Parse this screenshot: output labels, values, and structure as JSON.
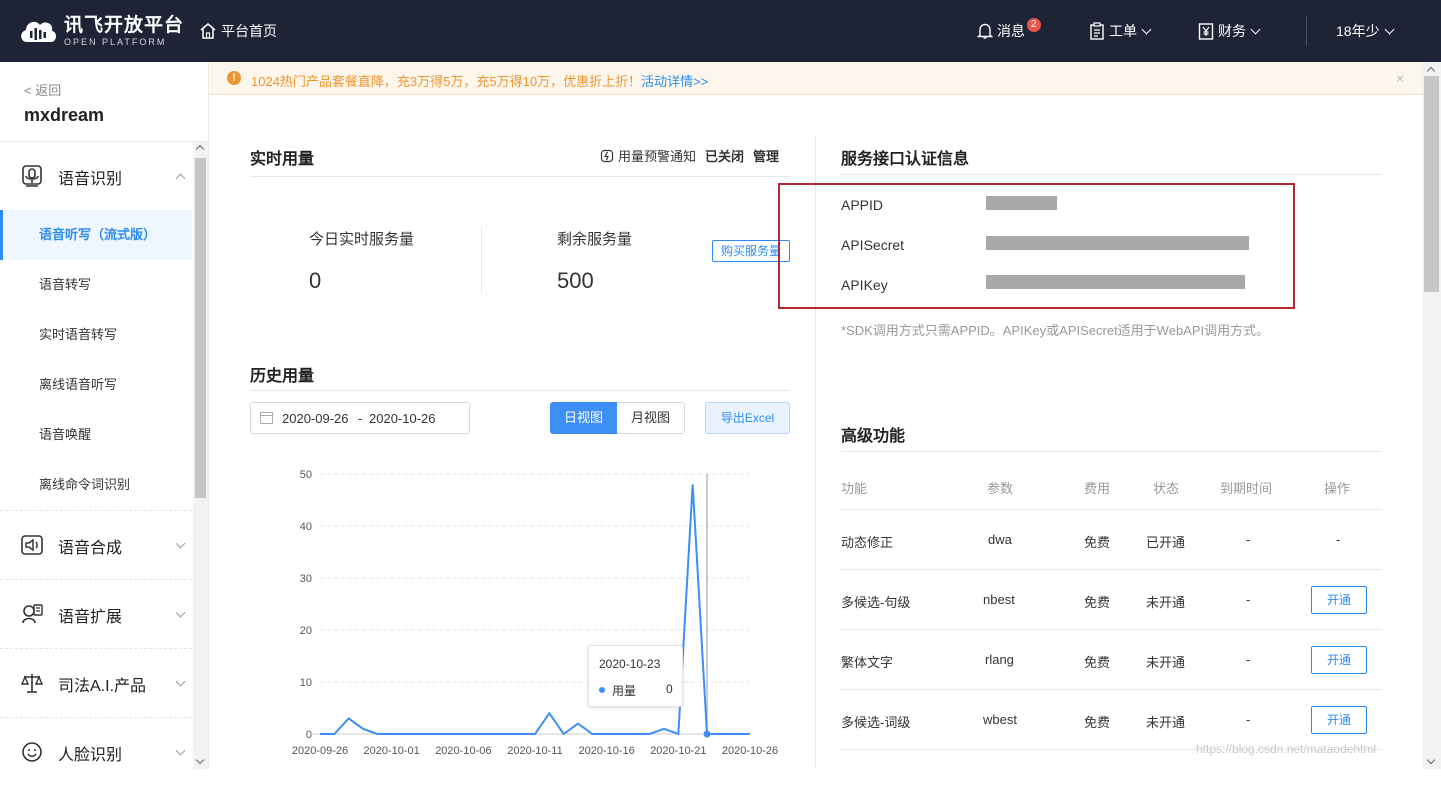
{
  "topbar": {
    "logo_main": "讯飞开放平台",
    "logo_sub": "OPEN PLATFORM",
    "home": "平台首页",
    "messages": "消息",
    "message_count": "2",
    "tickets": "工单",
    "finance": "财务",
    "user": "18年少"
  },
  "sidebar": {
    "back": "< 返回",
    "app_name": "mxdream",
    "groups": [
      {
        "label": "语音识别",
        "icon": "speech-recognition-icon"
      },
      {
        "label": "语音合成",
        "icon": "speech-synthesis-icon"
      },
      {
        "label": "语音扩展",
        "icon": "speech-extension-icon"
      },
      {
        "label": "司法A.I.产品",
        "icon": "justice-ai-icon"
      },
      {
        "label": "人脸识别",
        "icon": "face-recognition-icon"
      }
    ],
    "sub_items": [
      {
        "label": "语音听写（流式版）",
        "active": true
      },
      {
        "label": "语音转写"
      },
      {
        "label": "实时语音转写"
      },
      {
        "label": "离线语音听写"
      },
      {
        "label": "语音唤醒"
      },
      {
        "label": "离线命令词识别"
      }
    ]
  },
  "notice": {
    "text": "1024热门产品套餐直降，充3万得5万，充5万得10万，优惠折上折！",
    "link": "活动详情>>",
    "close": "×"
  },
  "realtime": {
    "title": "实时用量",
    "alert_label": "用量预警通知",
    "alert_status": "已关闭",
    "manage": "管理",
    "today_label": "今日实时服务量",
    "today_value": "0",
    "remaining_label": "剩余服务量",
    "remaining_value": "500",
    "buy": "购买服务量"
  },
  "history": {
    "title": "历史用量",
    "date_start": "2020-09-26",
    "date_sep": "-",
    "date_end": "2020-10-26",
    "day_view": "日视图",
    "month_view": "月视图",
    "export": "导出Excel",
    "tooltip": {
      "date": "2020-10-23",
      "series": "用量",
      "value": "0"
    }
  },
  "chart_data": {
    "type": "line",
    "x_tick_labels": [
      "2020-09-26",
      "2020-10-01",
      "2020-10-06",
      "2020-10-11",
      "2020-10-16",
      "2020-10-21",
      "2020-10-26"
    ],
    "y_tick_labels": [
      "0",
      "10",
      "20",
      "30",
      "40",
      "50"
    ],
    "ylim": [
      0,
      50
    ],
    "x": [
      "2020-09-26",
      "2020-09-27",
      "2020-09-28",
      "2020-09-29",
      "2020-09-30",
      "2020-10-01",
      "2020-10-02",
      "2020-10-03",
      "2020-10-04",
      "2020-10-05",
      "2020-10-06",
      "2020-10-07",
      "2020-10-08",
      "2020-10-09",
      "2020-10-10",
      "2020-10-11",
      "2020-10-12",
      "2020-10-13",
      "2020-10-14",
      "2020-10-15",
      "2020-10-16",
      "2020-10-17",
      "2020-10-18",
      "2020-10-19",
      "2020-10-20",
      "2020-10-21",
      "2020-10-22",
      "2020-10-23",
      "2020-10-24",
      "2020-10-25",
      "2020-10-26"
    ],
    "series": [
      {
        "name": "用量",
        "color": "#3d8ff5",
        "values": [
          0,
          0,
          3,
          1,
          0,
          0,
          0,
          0,
          0,
          0,
          0,
          0,
          0,
          0,
          0,
          0,
          4,
          0,
          2,
          0,
          0,
          0,
          0,
          0,
          1,
          0,
          48,
          0,
          0,
          0,
          0
        ]
      }
    ],
    "grid": true,
    "highlight_x": "2020-10-23"
  },
  "auth": {
    "title": "服务接口认证信息",
    "rows": [
      {
        "label": "APPID"
      },
      {
        "label": "APISecret"
      },
      {
        "label": "APIKey"
      }
    ],
    "note": "*SDK调用方式只需APPID。APIKey或APISecret适用于WebAPI调用方式。"
  },
  "advanced": {
    "title": "高级功能",
    "headers": [
      "功能",
      "参数",
      "费用",
      "状态",
      "到期时间",
      "操作"
    ],
    "rows": [
      {
        "name": "动态修正",
        "param": "dwa",
        "fee": "免费",
        "status": "已开通",
        "expiry": "-",
        "action": "-"
      },
      {
        "name": "多候选-句级",
        "param": "nbest",
        "fee": "免费",
        "status": "未开通",
        "expiry": "-",
        "action": "开通"
      },
      {
        "name": "繁体文字",
        "param": "rlang",
        "fee": "免费",
        "status": "未开通",
        "expiry": "-",
        "action": "开通"
      },
      {
        "name": "多候选-词级",
        "param": "wbest",
        "fee": "免费",
        "status": "未开通",
        "expiry": "-",
        "action": "开通"
      }
    ]
  },
  "watermark": "https://blog.csdn.net/mataodehtml",
  "colors": {
    "accent": "#2d8cf0",
    "topbar": "#1f2336",
    "notice": "#f0962f",
    "highlight_box": "#b4282f"
  }
}
